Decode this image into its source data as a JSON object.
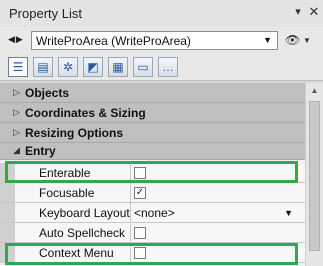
{
  "window": {
    "title": "Property List",
    "pin_icon": "pin-icon",
    "close_icon": "close-icon",
    "close_glyph": "✕",
    "pin_glyph": "▾"
  },
  "selector": {
    "nav_glyph": "◀▶",
    "object_name": "WriteProArea (WriteProArea)",
    "caret": "▼",
    "eye_glyph": "👁",
    "eye_caret": "▼"
  },
  "tabs": [
    {
      "name": "list-view-icon",
      "glyph": "☰",
      "active": true
    },
    {
      "name": "form-icon",
      "glyph": "▤"
    },
    {
      "name": "settings-icon",
      "glyph": "✲"
    },
    {
      "name": "objects-icon",
      "glyph": "◩"
    },
    {
      "name": "chart-icon",
      "glyph": "▦"
    },
    {
      "name": "screen-icon",
      "glyph": "▭"
    },
    {
      "name": "more-icon",
      "glyph": "…"
    }
  ],
  "categories": [
    {
      "label": "Objects",
      "toggle": "▷"
    },
    {
      "label": "Coordinates & Sizing",
      "toggle": "▷"
    },
    {
      "label": "Resizing Options",
      "toggle": "▷"
    },
    {
      "label": "Entry",
      "toggle": "◢"
    }
  ],
  "properties": [
    {
      "label": "Enterable",
      "type": "checkbox",
      "checked": false,
      "mark": ""
    },
    {
      "label": "Focusable",
      "type": "checkbox",
      "checked": true,
      "mark": "✓"
    },
    {
      "label": "Keyboard Layout",
      "type": "select",
      "value": "<none>",
      "caret": "▼"
    },
    {
      "label": "Auto Spellcheck",
      "type": "checkbox",
      "checked": false,
      "mark": ""
    },
    {
      "label": "Context Menu",
      "type": "checkbox",
      "checked": false,
      "mark": ""
    }
  ],
  "scrollbar": {
    "up_glyph": "▲"
  },
  "colors": {
    "highlight": "#2fa84f",
    "category_bg": "#bfbfbf"
  }
}
